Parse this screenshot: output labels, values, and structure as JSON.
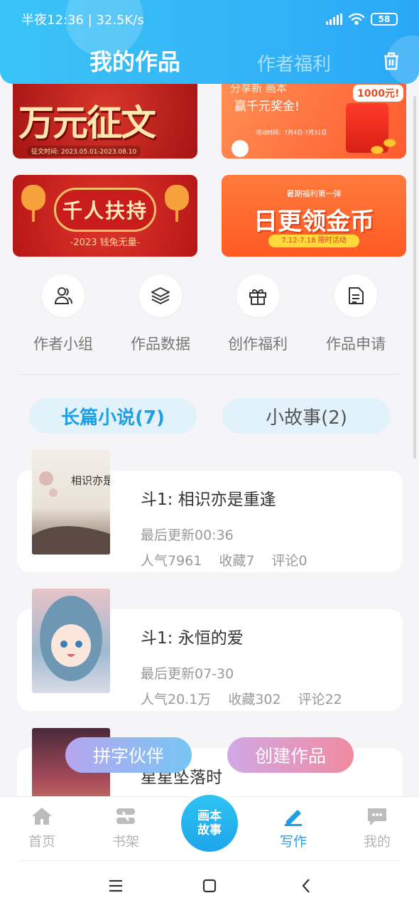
{
  "status_bar": {
    "time": "半夜12:36 | 32.5K/s",
    "battery": "58"
  },
  "header": {
    "tab_active": "我的作品",
    "tab_inactive": "作者福利"
  },
  "banners": {
    "b1": {
      "title": "万元征文",
      "date": "征文时间: 2023.05.01-2023.08.10"
    },
    "b2": {
      "top": "分享新  画本",
      "sub": "赢千元奖金!",
      "badge": "1000元!",
      "tiny": "活动时间：7月4日-7月31日"
    },
    "b3": {
      "title": "千人扶持",
      "sub": "-2023 钱兔无量-"
    },
    "b4": {
      "top": "暑期福利第一弹",
      "title": "日更领金币",
      "date": "7.12-7.18 限时活动"
    }
  },
  "quick_actions": [
    {
      "label": "作者小组",
      "icon": "people-icon"
    },
    {
      "label": "作品数据",
      "icon": "layers-icon"
    },
    {
      "label": "创作福利",
      "icon": "gift-icon"
    },
    {
      "label": "作品申请",
      "icon": "document-icon"
    }
  ],
  "category_tabs": {
    "active": "长篇小说(7)",
    "inactive": "小故事(2)"
  },
  "works": [
    {
      "title": "斗1: 相识亦是重逢",
      "updated": "最后更新00:36",
      "popularity": "人气7961",
      "favorites": "收藏7",
      "comments": "评论0",
      "cover_text": "相识亦是重逢"
    },
    {
      "title": "斗1: 永恒的爱",
      "updated": "最后更新07-30",
      "popularity": "人气20.1万",
      "favorites": "收藏302",
      "comments": "评论22"
    },
    {
      "title": "星星坠落时"
    }
  ],
  "floating_buttons": {
    "partner": "拼字伙伴",
    "create": "创建作品"
  },
  "bottom_nav": {
    "home": "首页",
    "bookshelf": "书架",
    "center": "画本故事",
    "center_line1": "画本",
    "center_line2": "故事",
    "write": "写作",
    "mine": "我的"
  },
  "colors": {
    "accent": "#1da0e4",
    "header": "#35b6f6"
  }
}
